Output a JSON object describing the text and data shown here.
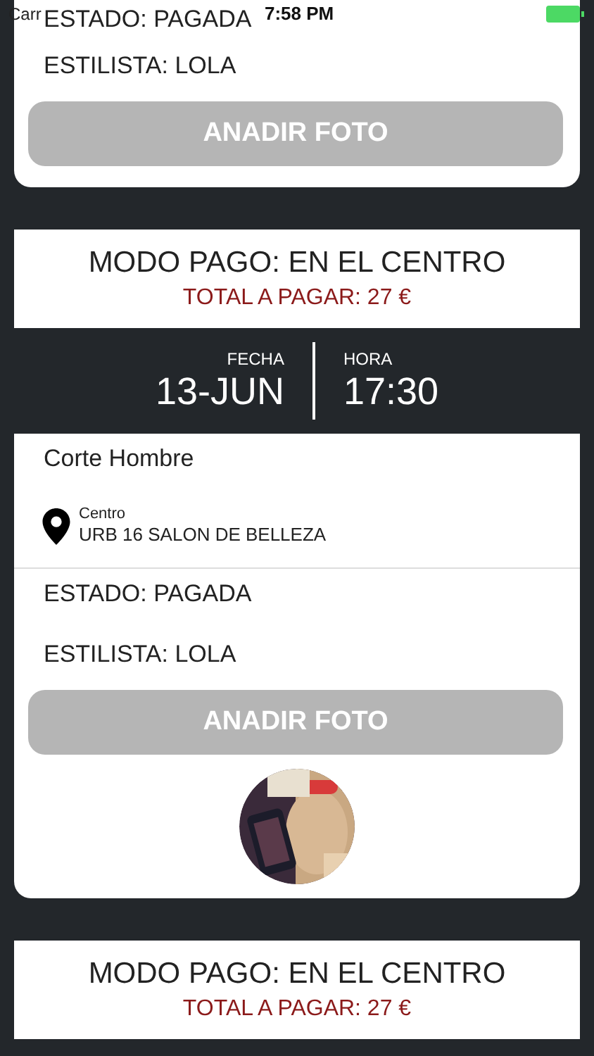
{
  "status_bar": {
    "carrier": "Carr",
    "time": "7:58 PM"
  },
  "sections": [
    {
      "kind": "details_tail",
      "estado": "ESTADO: PAGADA",
      "estilista": "ESTILISTA: LOLA",
      "button": {
        "label": "ANADIR FOTO",
        "disabled": true
      }
    },
    {
      "kind": "payment",
      "modo": "MODO PAGO: EN EL CENTRO",
      "total": "TOTAL A PAGAR: 27 €"
    },
    {
      "kind": "datetime",
      "date_label": "FECHA",
      "date": "13-JUN",
      "time_label": "HORA",
      "time": "17:30"
    },
    {
      "kind": "details",
      "service": "Corte Hombre",
      "place_label": "Centro",
      "place": "URB 16 SALON DE BELLEZA",
      "estado": "ESTADO: PAGADA",
      "estilista": "ESTILISTA: LOLA",
      "button": {
        "label": "ANADIR FOTO",
        "disabled": true
      }
    },
    {
      "kind": "payment",
      "modo": "MODO PAGO: EN EL CENTRO",
      "total": "TOTAL A PAGAR: 27 €"
    }
  ]
}
